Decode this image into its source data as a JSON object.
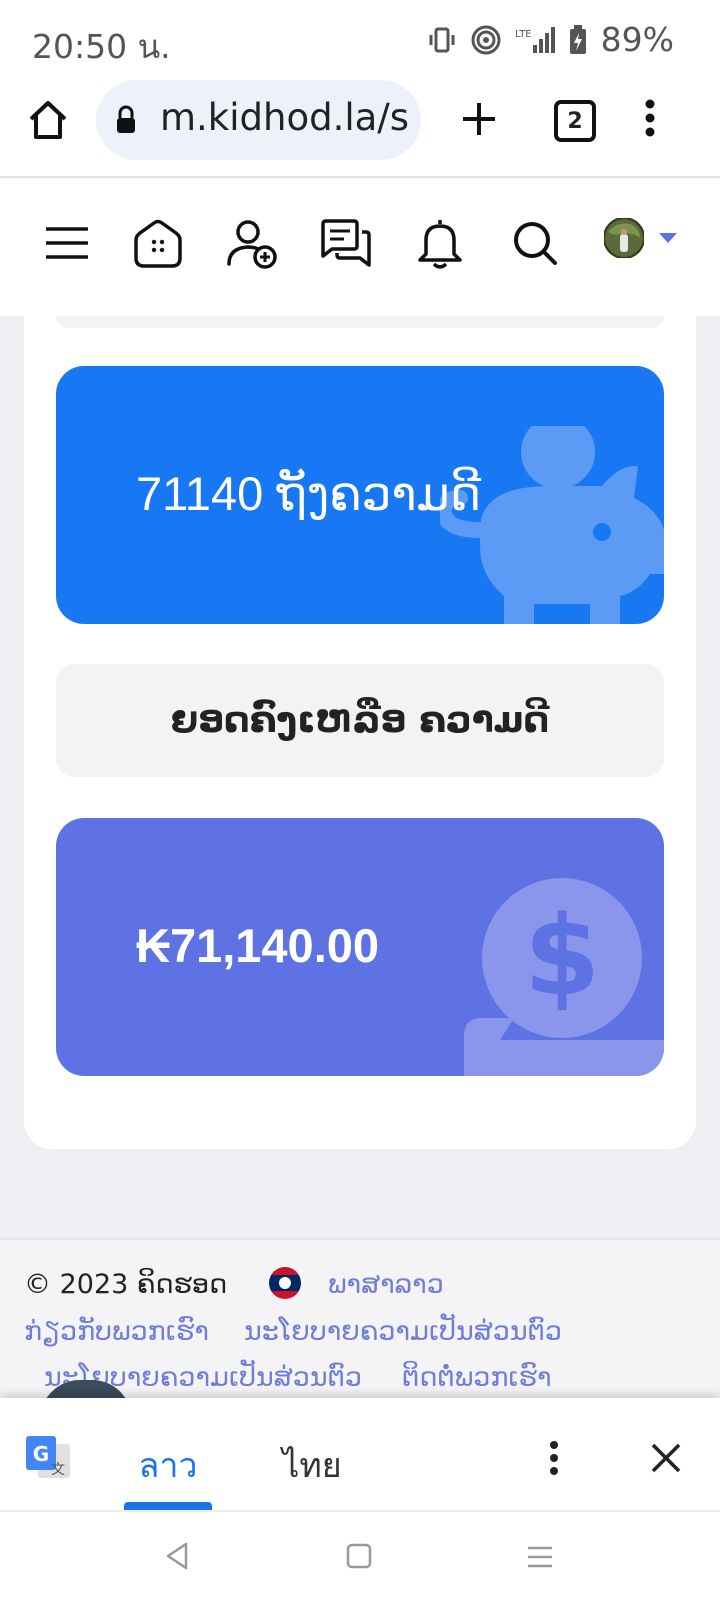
{
  "status_bar": {
    "time": "20:50 น.",
    "battery": "89%"
  },
  "browser": {
    "url": "m.kidhod.la/s",
    "tab_count": "2"
  },
  "site_nav": {
    "icons": [
      "menu-icon",
      "home-icon",
      "add-friend-icon",
      "messages-icon",
      "notifications-icon",
      "search-icon",
      "avatar",
      "dropdown-caret-icon"
    ]
  },
  "main": {
    "points_label": "71140 ຖັງຄວາມດີ",
    "balance_header": "ຍອດຄົງເຫລືອ ຄວາມດີ",
    "balance_amount": "₭71,140.00"
  },
  "footer": {
    "copyright": "© 2023 ຄິດຮອດ",
    "language": "ພາສາລາວ",
    "links": [
      "ກ່ຽວກັບພວກເຮົາ",
      "ນະໂຍບາຍຄວາມເປັນສ່ວນຕົວ",
      "ນະໂຍບາຍຄວາມເປັນສ່ວນຕົວ",
      "ຕິດຕໍ່ພວກເຮົາ"
    ]
  },
  "translate_bar": {
    "source_lang": "ลาว",
    "target_lang": "ไทย"
  },
  "colors": {
    "blue_card": "#1877f2",
    "purple_card": "#5f72e4",
    "link": "#6f7fd8"
  }
}
